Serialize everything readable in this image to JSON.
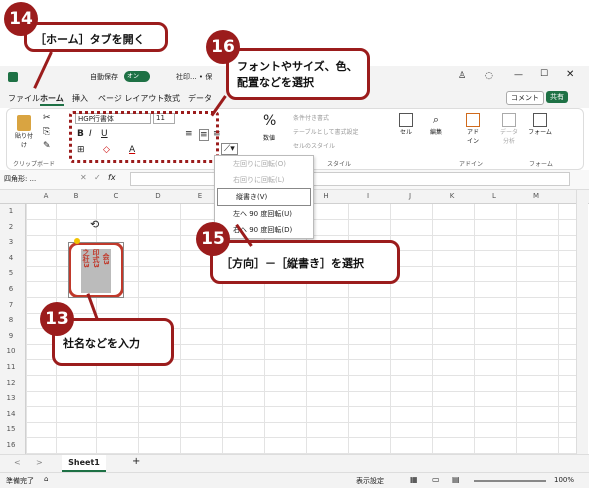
{
  "callouts": {
    "c14": {
      "num": "14",
      "text": "［ホーム］タブを開く"
    },
    "c16": {
      "num": "16",
      "text": "フォントやサイズ、色、配置などを選択"
    },
    "c15": {
      "num": "15",
      "text": "［方向］－［縦書き］を選択"
    },
    "c13": {
      "num": "13",
      "text": "社名などを入力"
    }
  },
  "titlebar": {
    "autosave": "自動保存",
    "toggle": "オン",
    "filename": "社印... • 保"
  },
  "tabs": [
    "ファイル",
    "ホーム",
    "挿入",
    "ページ レイアウト",
    "数式",
    "データ"
  ],
  "comment_btn": "コメント",
  "share_btn": "共有",
  "ribbon": {
    "paste": "貼り付け",
    "clipboard": "クリップボード",
    "font_name": "HGP行書体",
    "font_size": "11",
    "percent": "%",
    "number": "数値",
    "cond_format": "条件付き書式",
    "table_format": "テーブルとして書式設定",
    "cell_style": "セルのスタイル",
    "style": "スタイル",
    "cell": "セル",
    "edit": "編集",
    "addin": "アド\nイン",
    "addin_group": "アドイン",
    "data_analysis": "データ\n分析",
    "form": "フォーム",
    "form_group": "フォーム"
  },
  "namebox": "四角形: ...",
  "fx": "fx",
  "columns": [
    "A",
    "B",
    "C",
    "D",
    "E",
    "F",
    "G",
    "H",
    "I",
    "J",
    "K",
    "L",
    "M",
    "N"
  ],
  "rows": [
    "1",
    "2",
    "3",
    "4",
    "5",
    "6",
    "7",
    "8",
    "9",
    "10",
    "11",
    "12",
    "13",
    "14",
    "15",
    "16"
  ],
  "menu": {
    "items": [
      "左回りに回転(O)",
      "右回りに回転(L)",
      "縦書き(V)",
      "左へ 90 度回転(U)",
      "右へ 90 度回転(D)"
    ]
  },
  "stamp": {
    "col1": "之社3",
    "col2": "印式3",
    "col3": "会3",
    "col4": "株3"
  },
  "sheet": "Sheet1",
  "add_sheet": "+",
  "status": {
    "ready": "準備完了",
    "display": "表示設定",
    "zoom": "100%"
  }
}
